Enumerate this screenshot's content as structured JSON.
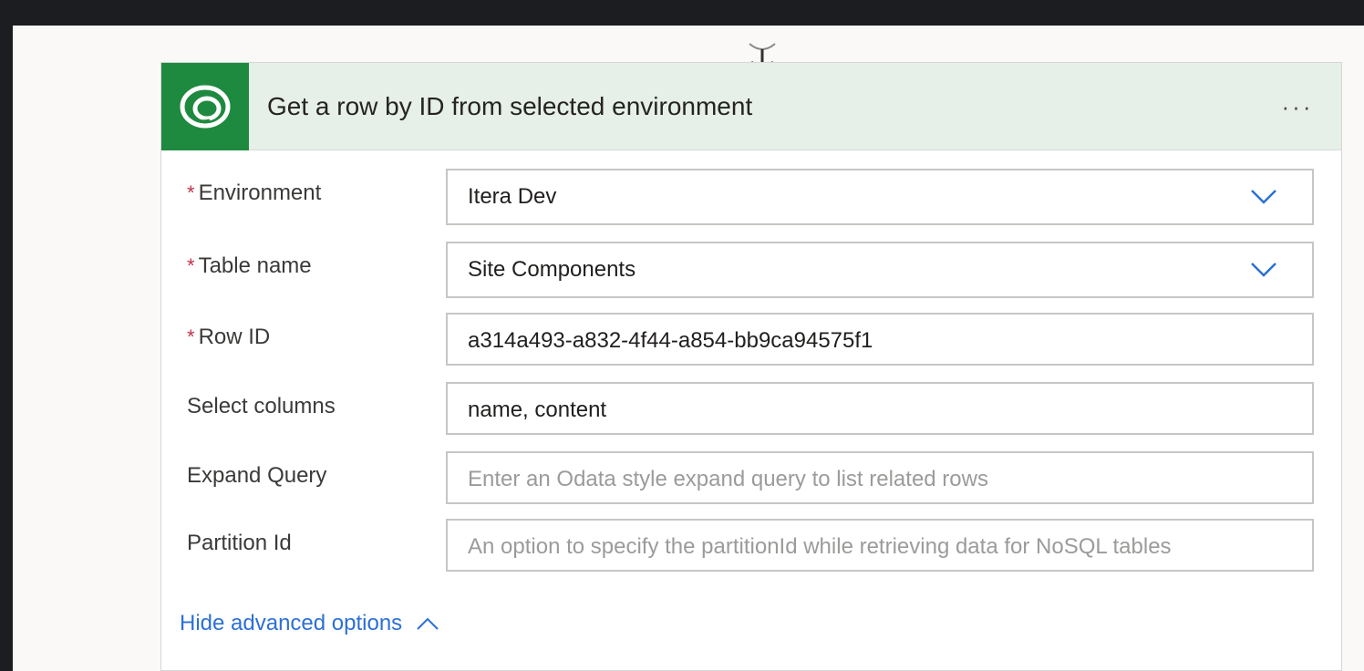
{
  "card": {
    "title": "Get a row by ID from selected environment",
    "more_menu": "···",
    "header_icon": "dataverse-icon",
    "accent_color": "#1e8a3f",
    "header_bg": "#e6efe8"
  },
  "fields": [
    {
      "label": "Environment",
      "required": true,
      "required_mark": "*",
      "value": "Itera Dev",
      "placeholder": "",
      "type": "dropdown"
    },
    {
      "label": "Table name",
      "required": true,
      "required_mark": "*",
      "value": "Site Components",
      "placeholder": "",
      "type": "dropdown"
    },
    {
      "label": "Row ID",
      "required": true,
      "required_mark": "*",
      "value": "a314a493-a832-4f44-a854-bb9ca94575f1",
      "placeholder": "",
      "type": "text"
    },
    {
      "label": "Select columns",
      "required": false,
      "required_mark": "",
      "value": "name, content",
      "placeholder": "",
      "type": "text"
    },
    {
      "label": "Expand Query",
      "required": false,
      "required_mark": "",
      "value": "",
      "placeholder": "Enter an Odata style expand query to list related rows",
      "type": "text"
    },
    {
      "label": "Partition Id",
      "required": false,
      "required_mark": "",
      "value": "",
      "placeholder": "An option to specify the partitionId while retrieving data for NoSQL tables",
      "type": "text"
    }
  ],
  "advanced_toggle": {
    "label": "Hide advanced options",
    "icon": "chevron-up-icon",
    "color": "#2d6fd6"
  },
  "connector": {
    "icon": "arrow-down-icon"
  }
}
